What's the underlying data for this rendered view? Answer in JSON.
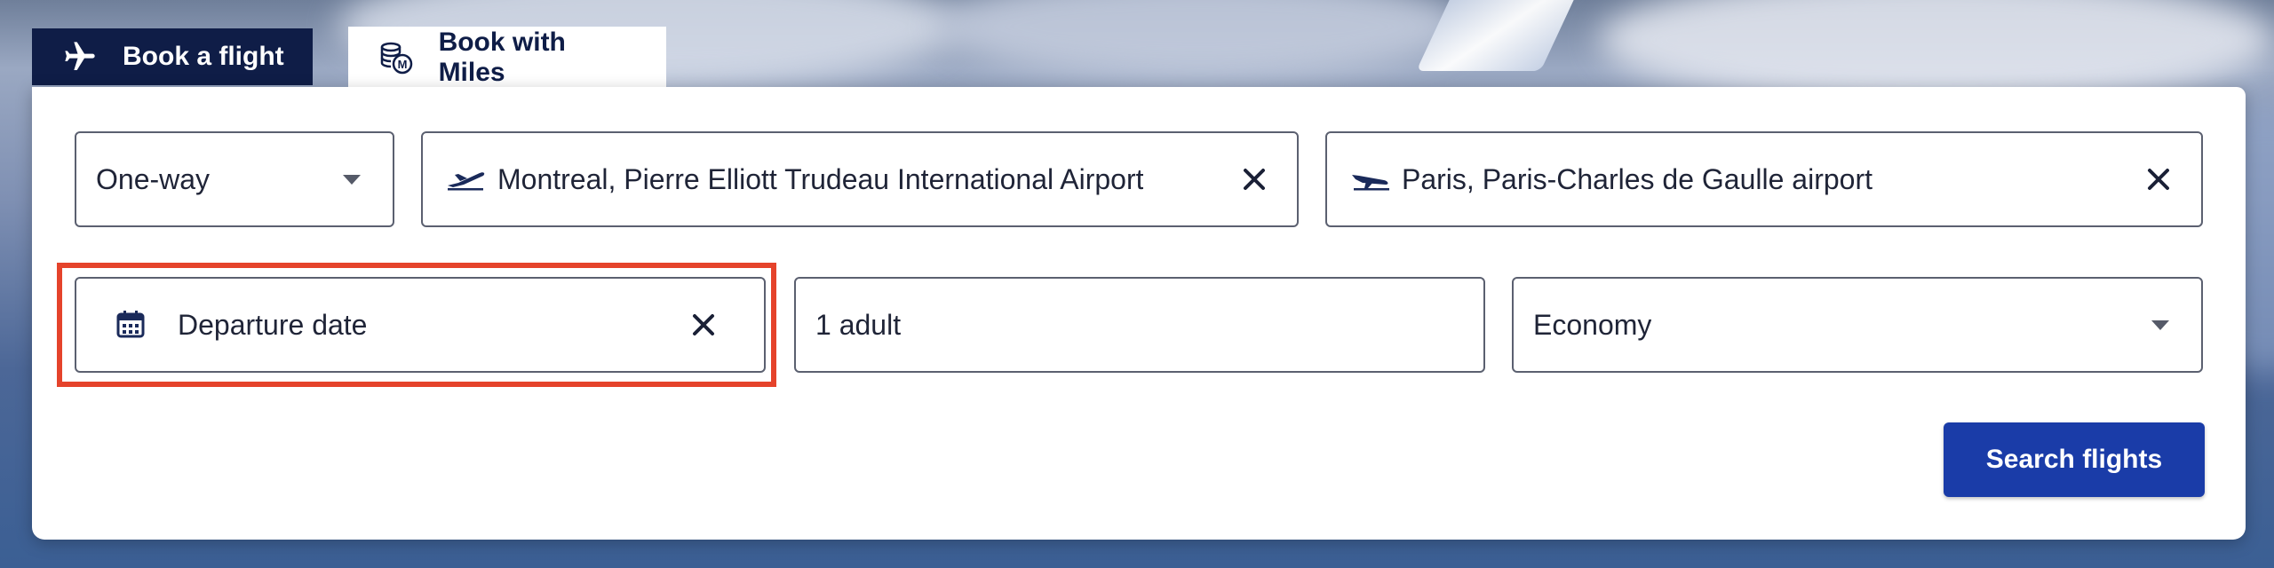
{
  "tabs": {
    "book_flight": "Book a flight",
    "book_miles": "Book with Miles"
  },
  "form": {
    "trip_type": "One-way",
    "origin": "Montreal, Pierre Elliott Trudeau International Airport",
    "destination": "Paris, Paris-Charles de Gaulle airport",
    "departure_date_label": "Departure date",
    "passengers": "1 adult",
    "cabin": "Economy",
    "search_label": "Search flights"
  },
  "icons": {
    "book_flight": "plane-icon",
    "book_miles": "miles-coins-icon",
    "origin": "takeoff-icon",
    "destination": "landing-icon",
    "date": "calendar-icon",
    "clear": "close-icon",
    "dropdown": "caret-down-icon"
  },
  "colors": {
    "navy": "#0f1d47",
    "primary_button": "#1a3ca8",
    "highlight": "#e5432b"
  }
}
